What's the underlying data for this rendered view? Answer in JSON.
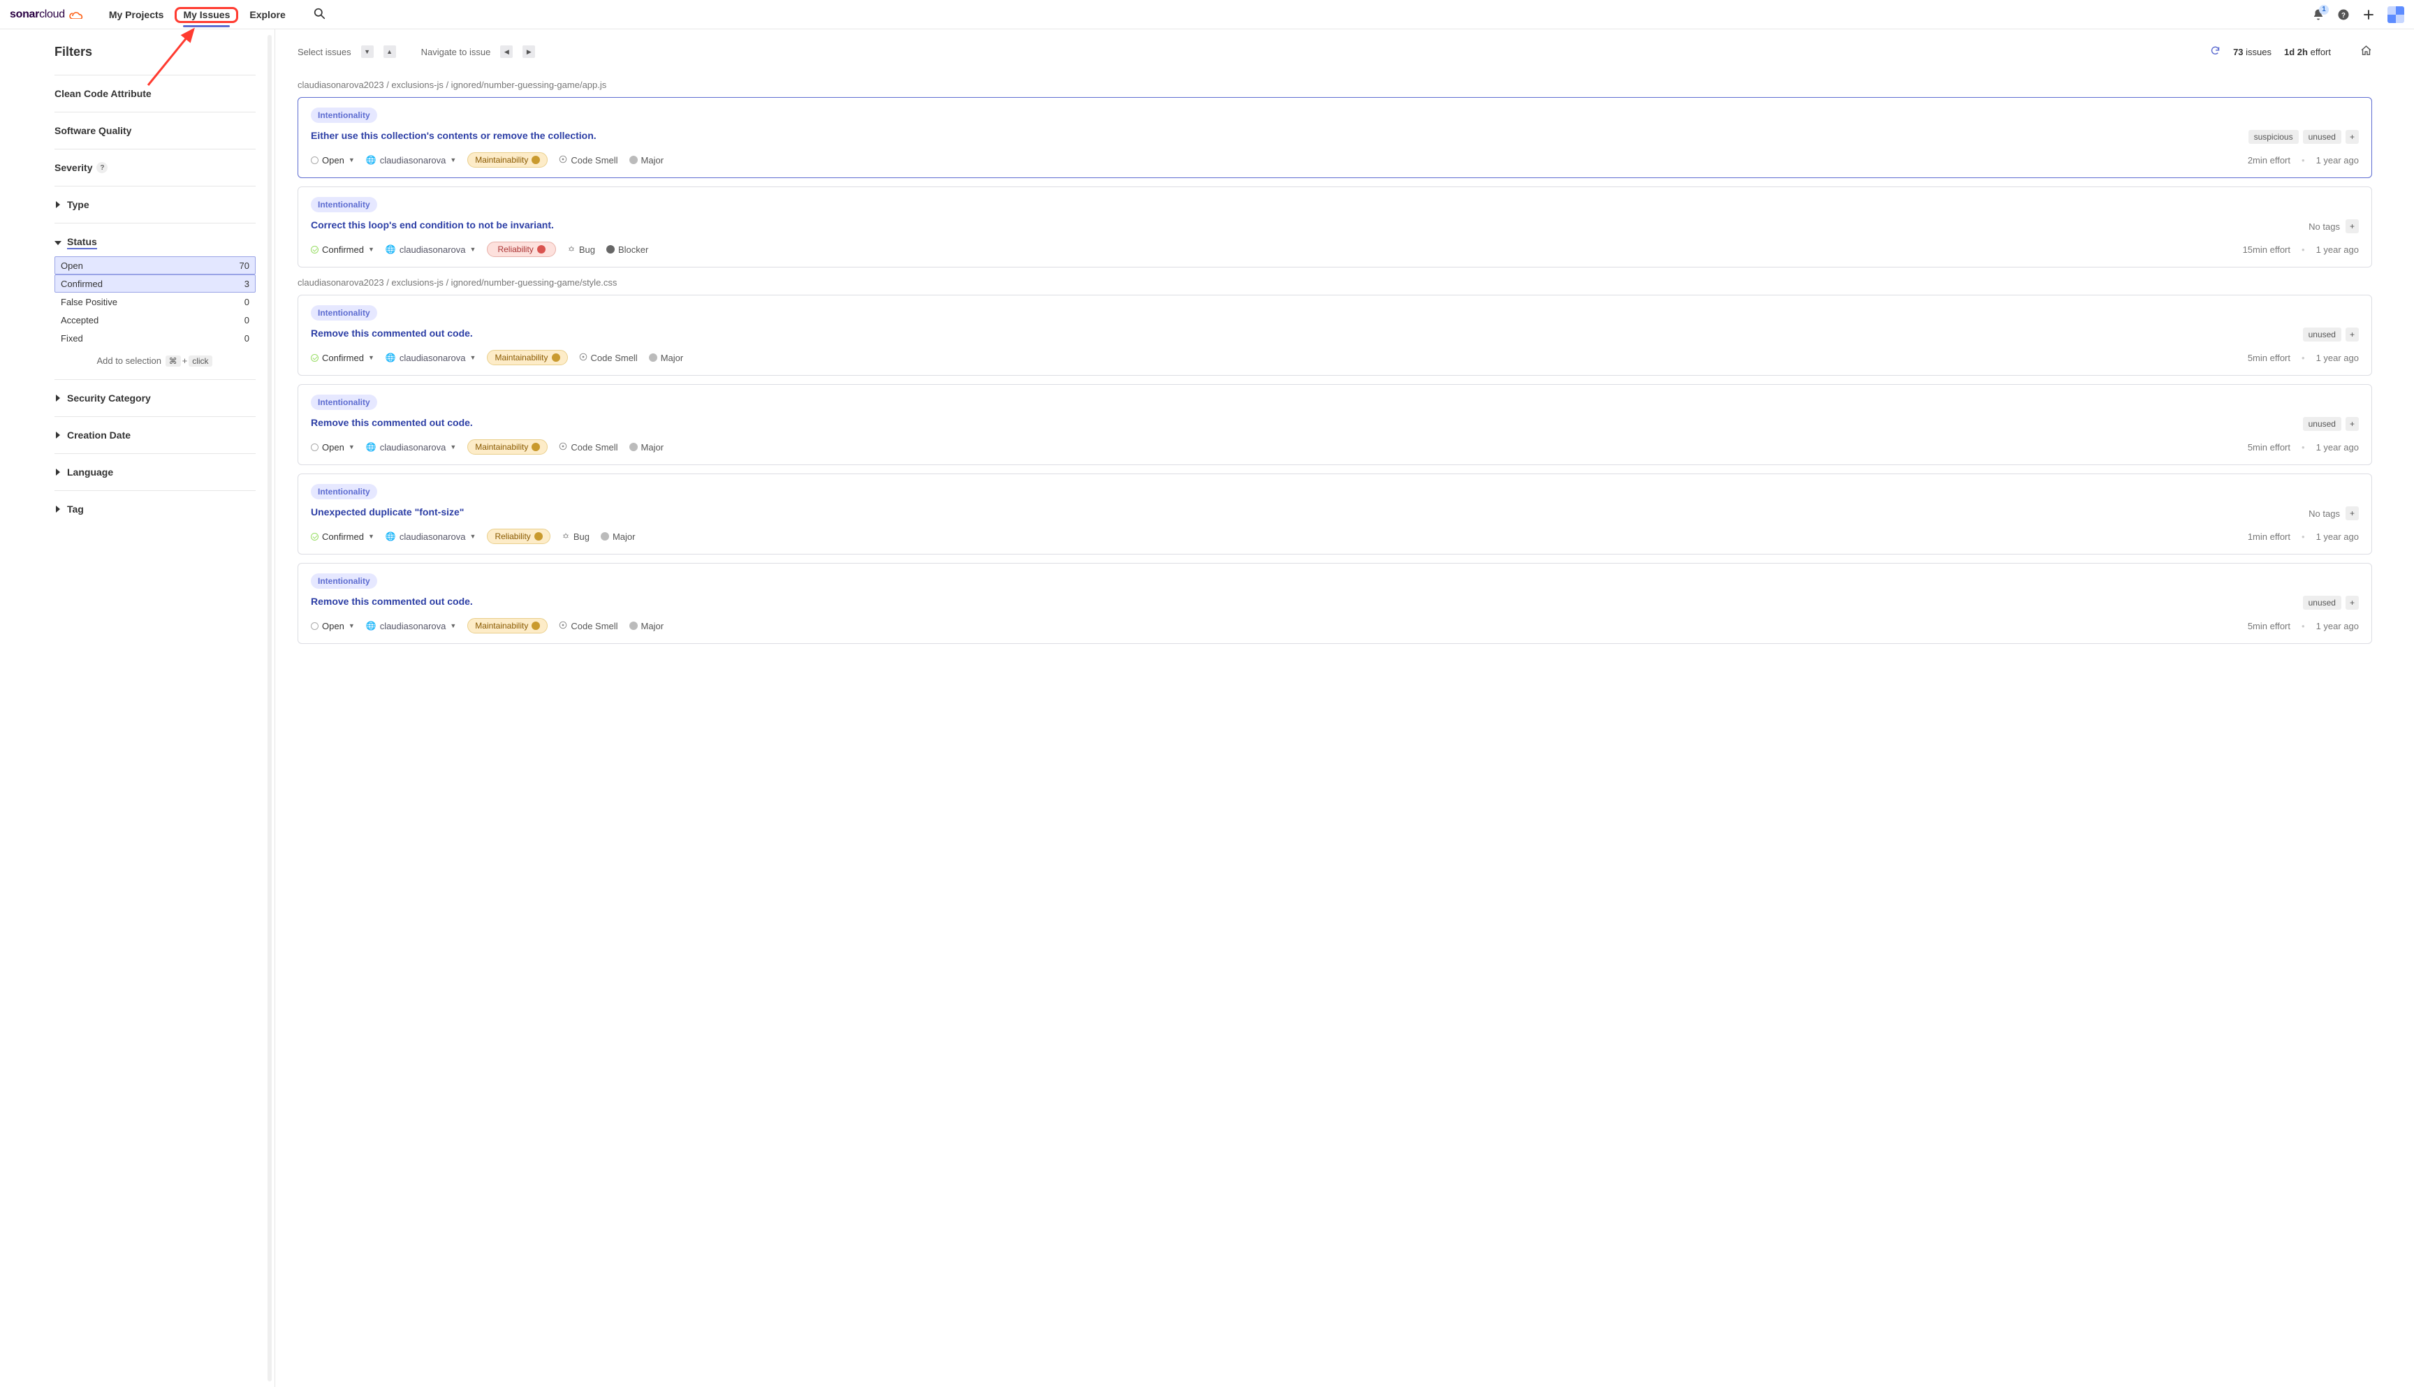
{
  "header": {
    "logo": {
      "brand": "sonar",
      "suffix": "cloud"
    },
    "nav": [
      {
        "label": "My Projects",
        "active": false
      },
      {
        "label": "My Issues",
        "active": true,
        "highlighted": true
      },
      {
        "label": "Explore",
        "active": false
      }
    ],
    "notif_badge": "1"
  },
  "sidebar": {
    "title": "Filters",
    "groups": [
      {
        "label": "Clean Code Attribute",
        "type": "plain"
      },
      {
        "label": "Software Quality",
        "type": "plain"
      },
      {
        "label": "Severity",
        "type": "help"
      },
      {
        "label": "Type",
        "type": "expand"
      }
    ],
    "status": {
      "label": "Status",
      "items": [
        {
          "label": "Open",
          "count": "70",
          "selected": true
        },
        {
          "label": "Confirmed",
          "count": "3",
          "selected": true
        },
        {
          "label": "False Positive",
          "count": "0",
          "selected": false
        },
        {
          "label": "Accepted",
          "count": "0",
          "selected": false
        },
        {
          "label": "Fixed",
          "count": "0",
          "selected": false
        }
      ],
      "hint_prefix": "Add to selection",
      "hint_key1": "⌘",
      "hint_plus": "+",
      "hint_key2": "click"
    },
    "after": [
      {
        "label": "Security Category"
      },
      {
        "label": "Creation Date"
      },
      {
        "label": "Language"
      },
      {
        "label": "Tag"
      }
    ]
  },
  "topbar": {
    "select_label": "Select issues",
    "nav_label": "Navigate to issue",
    "count_num": "73",
    "count_word": "issues",
    "effort_val": "1d 2h",
    "effort_word": "effort"
  },
  "groups": [
    {
      "path": "claudiasonarova2023 / exclusions-js / ignored/number-guessing-game/app.js",
      "issues": [
        {
          "chip": "Intentionality",
          "title": "Either use this collection's contents or remove the collection.",
          "tags": [
            "suspicious",
            "unused"
          ],
          "status": "Open",
          "status_kind": "open",
          "author": "claudiasonarova",
          "quality": "Maintainability",
          "quality_kind": "maint",
          "type": "Code Smell",
          "type_kind": "smell",
          "severity": "Major",
          "sev_kind": "major",
          "effort": "2min effort",
          "age": "1 year ago",
          "active": true
        },
        {
          "chip": "Intentionality",
          "title": "Correct this loop's end condition to not be invariant.",
          "tags": [],
          "notags": "No tags",
          "status": "Confirmed",
          "status_kind": "confirmed",
          "author": "claudiasonarova",
          "quality": "Reliability",
          "quality_kind": "rel",
          "type": "Bug",
          "type_kind": "bug",
          "severity": "Blocker",
          "sev_kind": "blocker",
          "effort": "15min effort",
          "age": "1 year ago",
          "active": false
        }
      ]
    },
    {
      "path": "claudiasonarova2023 / exclusions-js / ignored/number-guessing-game/style.css",
      "issues": [
        {
          "chip": "Intentionality",
          "title": "Remove this commented out code.",
          "tags": [
            "unused"
          ],
          "status": "Confirmed",
          "status_kind": "confirmed",
          "author": "claudiasonarova",
          "quality": "Maintainability",
          "quality_kind": "maint",
          "type": "Code Smell",
          "type_kind": "smell",
          "severity": "Major",
          "sev_kind": "major",
          "effort": "5min effort",
          "age": "1 year ago",
          "active": false
        },
        {
          "chip": "Intentionality",
          "title": "Remove this commented out code.",
          "tags": [
            "unused"
          ],
          "status": "Open",
          "status_kind": "open",
          "author": "claudiasonarova",
          "quality": "Maintainability",
          "quality_kind": "maint",
          "type": "Code Smell",
          "type_kind": "smell",
          "severity": "Major",
          "sev_kind": "major",
          "effort": "5min effort",
          "age": "1 year ago",
          "active": false
        },
        {
          "chip": "Intentionality",
          "title": "Unexpected duplicate \"font-size\"",
          "tags": [],
          "notags": "No tags",
          "status": "Confirmed",
          "status_kind": "confirmed",
          "author": "claudiasonarova",
          "quality": "Reliability",
          "quality_kind": "maint",
          "type": "Bug",
          "type_kind": "bug",
          "severity": "Major",
          "sev_kind": "major",
          "effort": "1min effort",
          "age": "1 year ago",
          "active": false
        },
        {
          "chip": "Intentionality",
          "title": "Remove this commented out code.",
          "tags": [
            "unused"
          ],
          "status": "Open",
          "status_kind": "open",
          "author": "claudiasonarova",
          "quality": "Maintainability",
          "quality_kind": "maint",
          "type": "Code Smell",
          "type_kind": "smell",
          "severity": "Major",
          "sev_kind": "major",
          "effort": "5min effort",
          "age": "1 year ago",
          "active": false
        }
      ]
    }
  ]
}
